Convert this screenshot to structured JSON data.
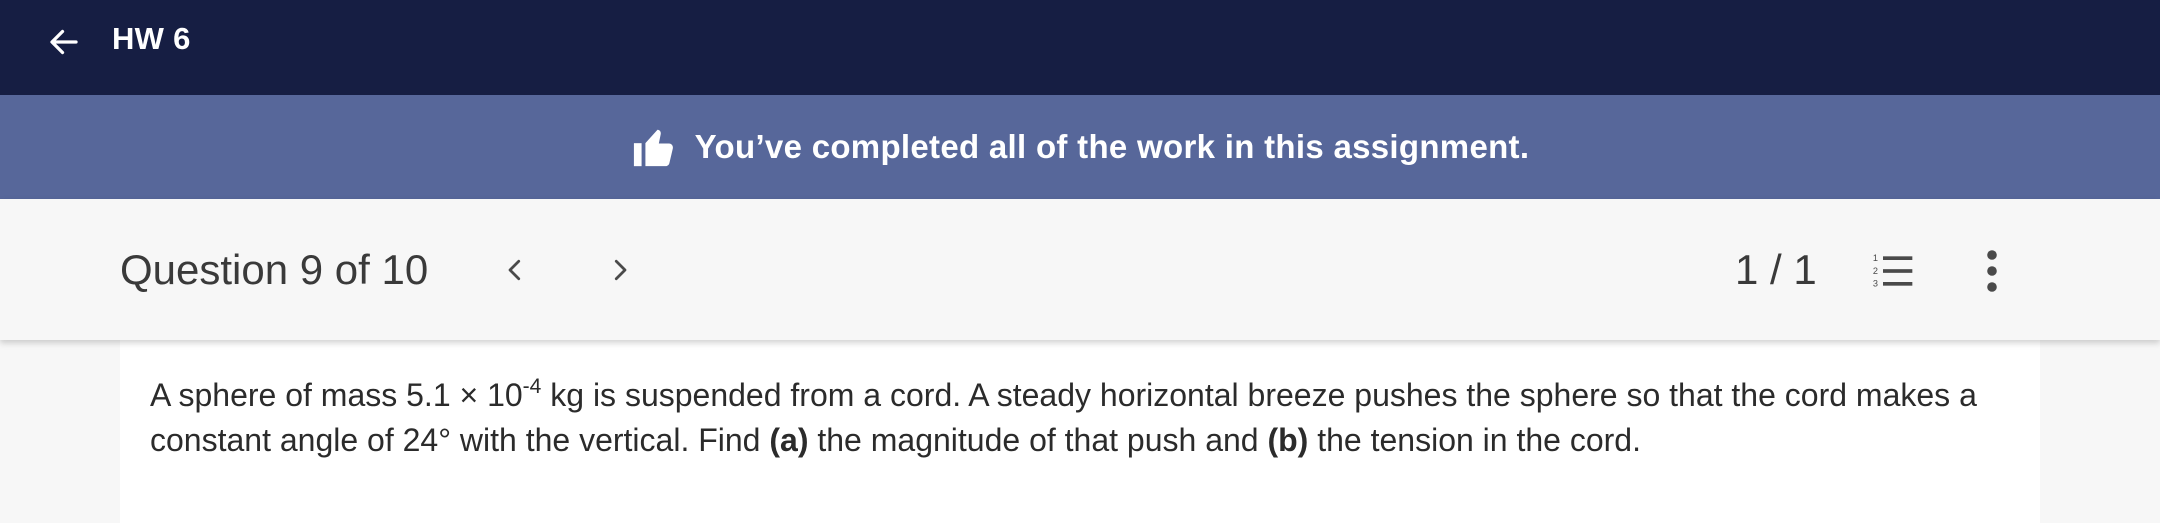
{
  "topbar": {
    "title": "HW 6",
    "back_icon": "arrow-left-icon"
  },
  "banner": {
    "icon": "thumbs-up-icon",
    "message": "You’ve completed all of the work in this assignment."
  },
  "question_header": {
    "title": "Question 9 of 10",
    "prev_icon": "chevron-left-icon",
    "next_icon": "chevron-right-icon",
    "score": "1 / 1",
    "list_icon": "numbered-list-icon",
    "more_icon": "more-vertical-icon"
  },
  "question": {
    "t1": "A sphere of mass 5.1 × 10",
    "exp": "-4",
    "t2": " kg is suspended from a cord. A steady horizontal breeze pushes the sphere so that the cord makes a constant angle of 24° with the vertical. Find ",
    "part_a": "(a)",
    "t3": " the magnitude of that push and ",
    "part_b": "(b)",
    "t4": " the tension in the cord."
  },
  "colors": {
    "topbar": "#161e43",
    "banner": "#57679a",
    "header_bg": "#f7f7f7",
    "text": "#3a3a3a"
  }
}
